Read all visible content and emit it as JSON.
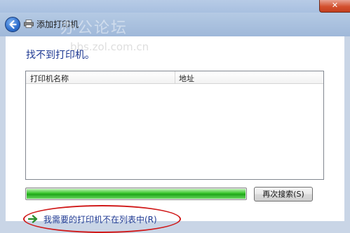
{
  "window": {
    "title": "添加打印机",
    "close_glyph": "✕",
    "watermark_main": "办公论坛",
    "watermark_url": "bbs.zol.com.cn"
  },
  "page": {
    "heading": "找不到打印机。"
  },
  "list": {
    "columns": [
      "打印机名称",
      "地址"
    ]
  },
  "search": {
    "progress_percent": 100,
    "button_label": "再次搜索(S)"
  },
  "link": {
    "label": "我需要的打印机不在列表中(R)"
  },
  "colors": {
    "heading": "#1f3a93",
    "progress": "#1fa51a",
    "highlight": "#d01919"
  }
}
